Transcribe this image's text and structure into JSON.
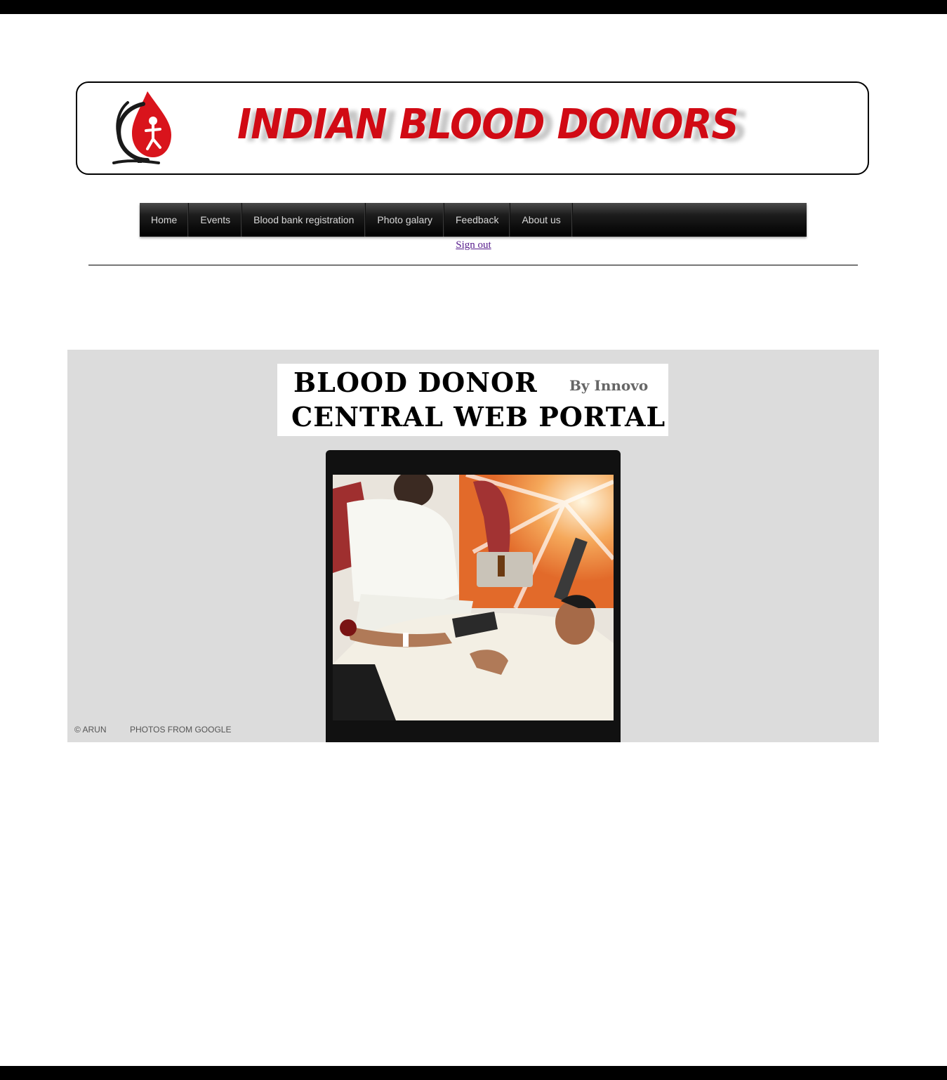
{
  "header": {
    "logo_icon": "blood-drop-globe-icon",
    "title": "INDIAN BLOOD DONORS",
    "title_color": "#d10a14"
  },
  "nav": {
    "items": [
      {
        "label": "Home"
      },
      {
        "label": "Events"
      },
      {
        "label": "Blood bank registration"
      },
      {
        "label": "Photo galary"
      },
      {
        "label": "Feedback"
      },
      {
        "label": "About us"
      }
    ],
    "signout": "Sign out"
  },
  "portal": {
    "line1": "BLOOD DONOR",
    "by": "By Innovo",
    "line2": "CENTRAL WEB PORTAL"
  },
  "slideshow": {
    "image": "blood-donation-photo"
  },
  "footer": {
    "copyright": "© ARUN",
    "photos_credit": "PHOTOS FROM GOOGLE"
  }
}
